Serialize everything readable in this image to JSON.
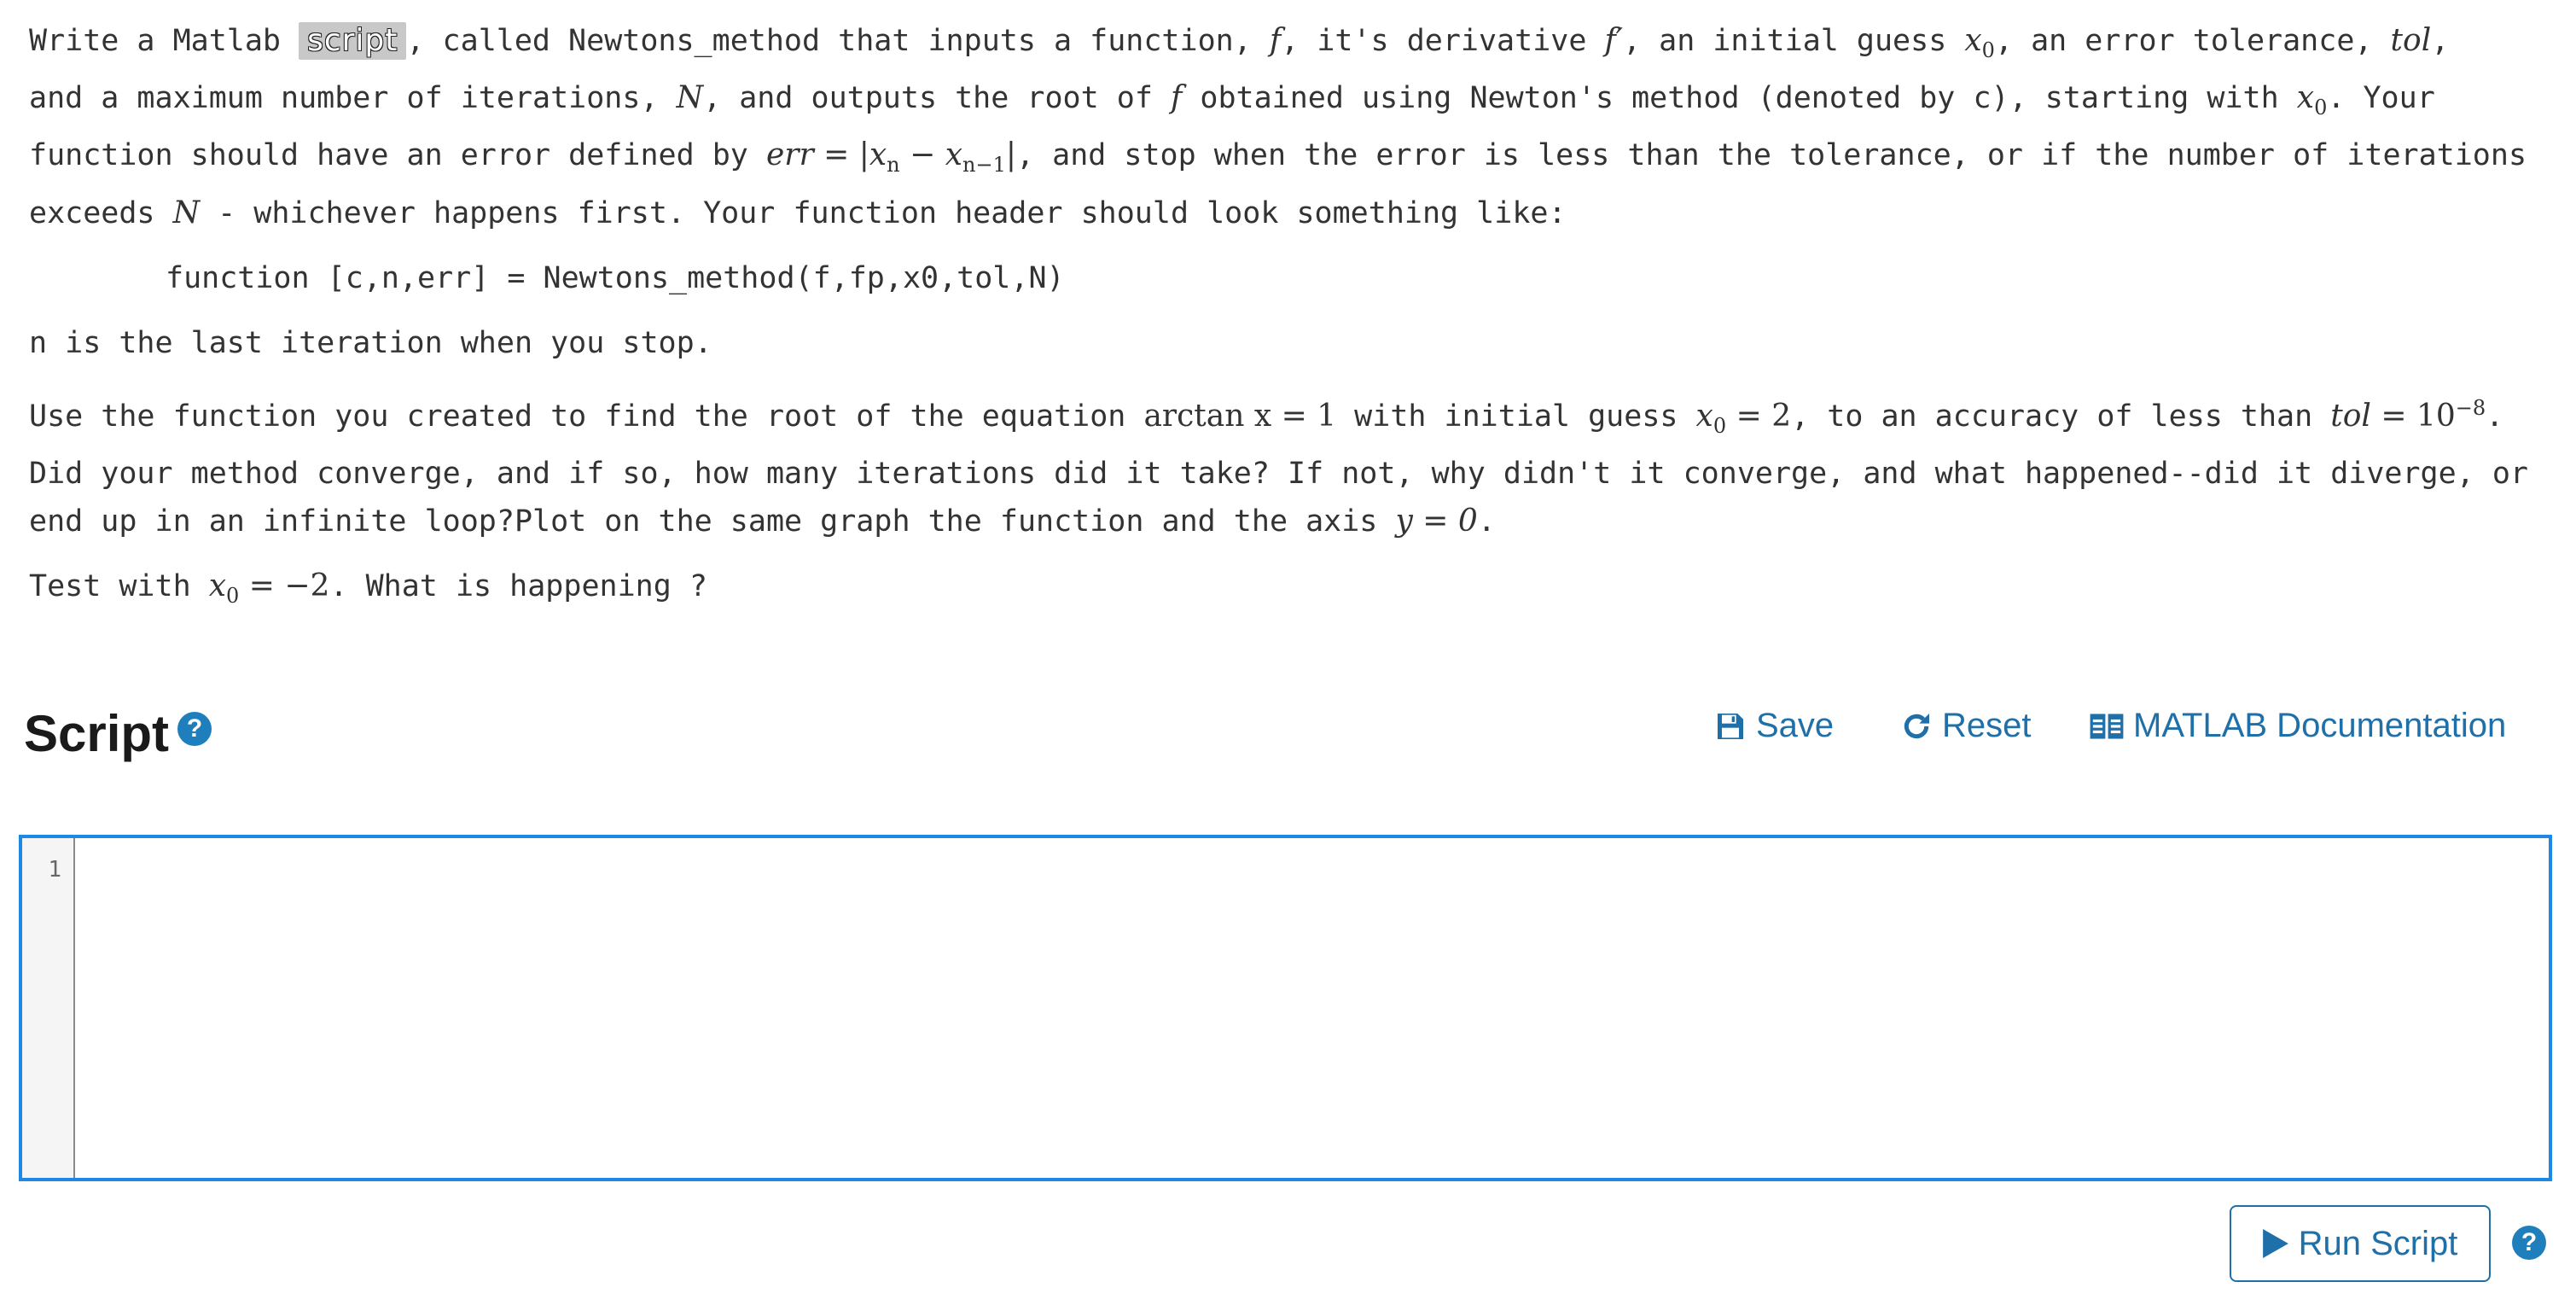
{
  "problem": {
    "p1": {
      "t1": "Write a Matlab ",
      "scribble": "script",
      "t2": ", called Newtons_method that inputs a function, ",
      "m_f": "f",
      "t3": ", it's derivative ",
      "m_fp": "f′",
      "t4": ", an initial guess ",
      "m_x0": "x",
      "m_x0_sub": "0",
      "t5": ", an error tolerance, ",
      "m_tol": "tol",
      "t6": ","
    },
    "p1_line2": {
      "t1": "and a maximum number of iterations, ",
      "m_N": "N",
      "t2": ", and outputs the root of ",
      "m_f": "f",
      "t3": " obtained using Newton's method (denoted by c), starting with ",
      "m_x0": "x",
      "m_x0_sub": "0",
      "t4": ". Your"
    },
    "p1_line3": {
      "t1": "function should have an error defined by ",
      "m_err": "err = |x",
      "m_err_sub1": "n",
      "m_err_mid": " − x",
      "m_err_sub2": "n−1",
      "m_err_end": "|",
      "t2": ", and stop when the error is less than the tolerance, or if the number of iterations"
    },
    "p1_line4": {
      "t1": "exceeds ",
      "m_N": "N",
      "t2": " - whichever happens first. Your function header should look something like:"
    },
    "code": "function [c,n,err] = Newtons_method(f,fp,x0,tol,N)",
    "p3": "n is the last iteration when you stop.",
    "p4_line1": {
      "t1": "Use the function you created to find the root of the equation ",
      "m_eq": "arctan x = 1",
      "t2": " with initial guess ",
      "m_x0": "x",
      "m_x0_sub": "0",
      "m_x0_val": " = 2",
      "t3": ", to an accuracy of less than ",
      "m_tol": "tol",
      "m_tol_val": " = 10",
      "m_tol_exp": "−8",
      "t4": "."
    },
    "p4_line2": "Did your method converge, and if so, how many iterations did it take? If not, why didn't it converge, and what happened--did it diverge, or",
    "p4_line3": {
      "t1": "end up in an infinite loop?Plot on the same graph the function and the axis ",
      "m_y": "y = 0",
      "t2": "."
    },
    "p5": {
      "t1": "Test with ",
      "m_x0": "x",
      "m_x0_sub": "0",
      "m_x0_val": " = −2",
      "t2": ". What is happening ?"
    }
  },
  "script_panel": {
    "title": "Script",
    "help_icon": "question-circle-icon",
    "actions": {
      "save": "Save",
      "reset": "Reset",
      "docs": "MATLAB Documentation"
    },
    "editor": {
      "line_numbers": [
        "1"
      ],
      "content": ""
    },
    "run_button": "Run Script"
  },
  "colors": {
    "accent_blue": "#1f6fa8",
    "editor_border": "#1e88e5",
    "help_icon": "#1f7fbd",
    "body_text": "#333333"
  }
}
